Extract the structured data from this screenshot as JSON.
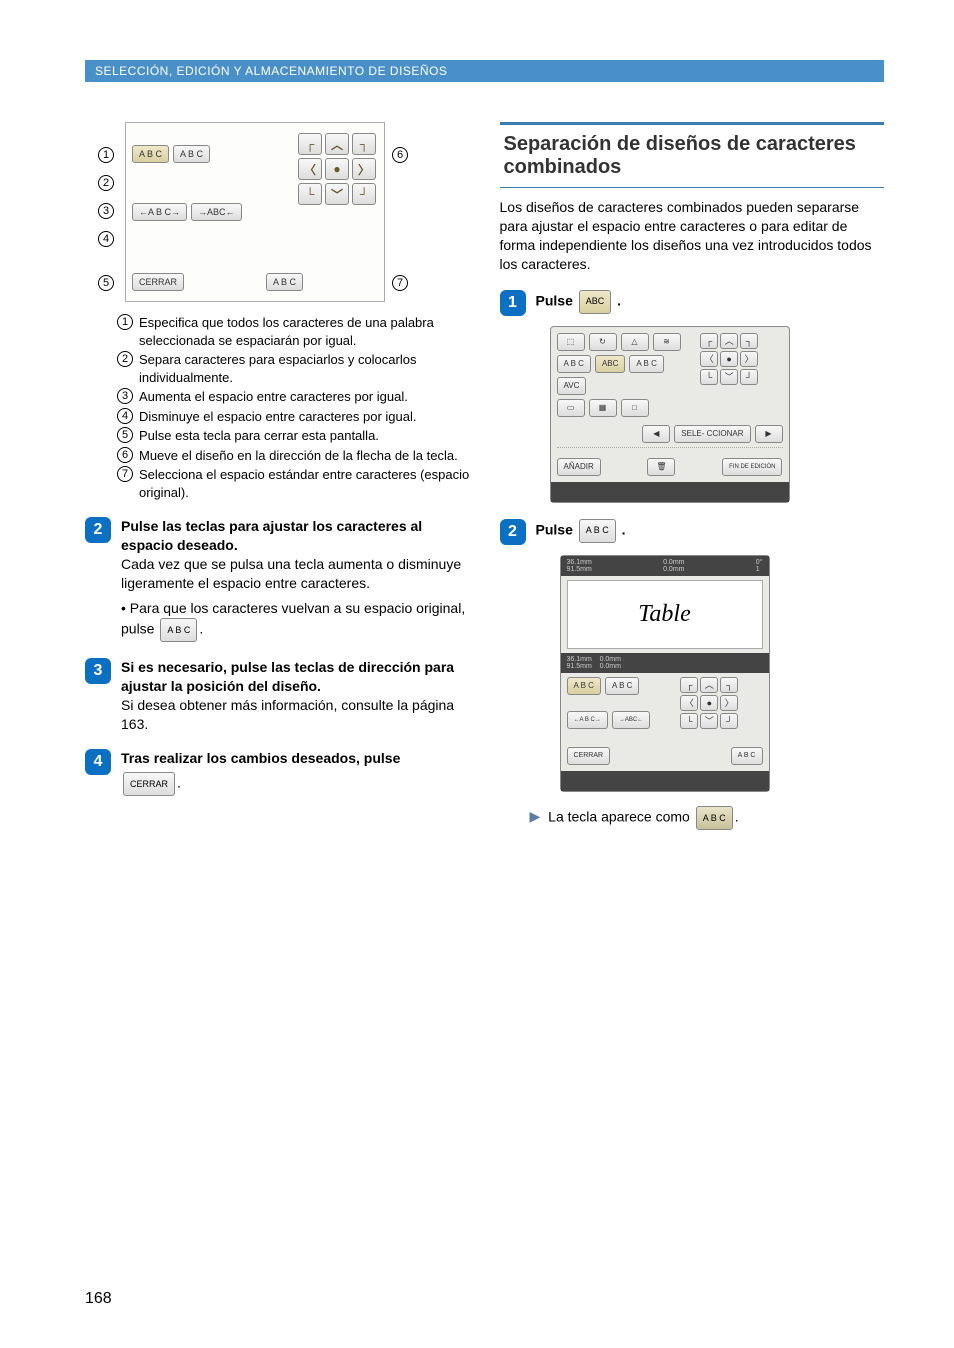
{
  "header": "SELECCIÓN, EDICIÓN Y ALMACENAMIENTO DE DISEÑOS",
  "pageNumber": "168",
  "diagram1": {
    "callouts_left": [
      "1",
      "2",
      "3",
      "4",
      "5"
    ],
    "callout_right_top": "6",
    "callout_right_bottom": "7",
    "btn_abc_sel": "A B C",
    "btn_abc_split": "A B C",
    "btn_wider": "←A B C→",
    "btn_narrower": "→ABC←",
    "btn_close": "CERRAR",
    "btn_reset": "A B C"
  },
  "annotations": [
    "Especifica que todos los caracteres de una palabra seleccionada se espaciarán por igual.",
    "Separa caracteres para espaciarlos y colocarlos individualmente.",
    "Aumenta el espacio entre caracteres por igual.",
    "Disminuye el espacio entre caracteres por igual.",
    "Pulse esta tecla para cerrar esta pantalla.",
    "Mueve el diseño en la dirección de la flecha de la tecla.",
    "Selecciona el espacio estándar entre caracteres (espacio original)."
  ],
  "left_steps": {
    "s2": {
      "title": "Pulse las teclas para ajustar los caracteres al espacio deseado.",
      "body": "Cada vez que se pulsa una tecla aumenta o disminuye ligeramente el espacio entre caracteres.",
      "bullet": "Para que los caracteres vuelvan a su espacio original, pulse",
      "btn": "A B C"
    },
    "s3": {
      "title": "Si es necesario, pulse las teclas de dirección para ajustar la posición del diseño.",
      "body": "Si desea obtener más información, consulte la página 163."
    },
    "s4": {
      "title": "Tras realizar los cambios deseados, pulse",
      "btn": "CERRAR"
    }
  },
  "right": {
    "heading": "Separación de diseños de caracteres combinados",
    "intro": "Los diseños de caracteres combinados pueden separarse para ajustar el espacio entre caracteres o para editar de forma independiente los diseños una vez introducidos todos los caracteres.",
    "s1": {
      "label": "Pulse",
      "btn": "ABC"
    },
    "s2": {
      "label": "Pulse",
      "btn": "A B C"
    },
    "screen1": {
      "btn_add": "AÑADIR",
      "btn_fin": "FIN DE EDICIÓN",
      "btn_select": "SELE- CCIONAR",
      "btn_abc1": "A B C",
      "btn_abc2": "ABC",
      "btn_abc3": "A B C",
      "btn_ayc": "AVC"
    },
    "screen2": {
      "dim1": "36.1mm",
      "dim2": "91.5mm",
      "offset1": "0.0mm",
      "offset2": "0.0mm",
      "deg": "0°",
      "one": "1",
      "sample": "Table",
      "btn_abc_sel": "A B C",
      "btn_abc_split": "A B C",
      "btn_wider": "←A B C→",
      "btn_narrower": "→ABC←",
      "btn_close": "CERRAR",
      "btn_reset": "A B C"
    },
    "result": {
      "text": "La tecla aparece como",
      "btn": "A B C"
    }
  }
}
